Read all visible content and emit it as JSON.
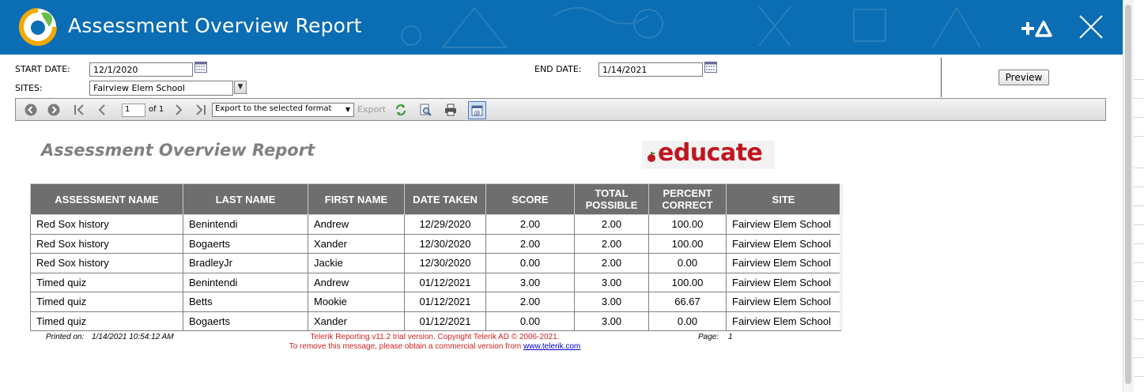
{
  "header": {
    "title": "Assessment Overview Report",
    "colors": {
      "bar": "#0b6db3",
      "text": "#ffffff"
    },
    "icons": {
      "logo": "circle-swoosh-logo",
      "accessibility": "plus-a-icon",
      "close": "close-icon"
    }
  },
  "params": {
    "start_date_label": "START DATE:",
    "start_date_value": "12/1/2020",
    "end_date_label": "END DATE:",
    "end_date_value": "1/14/2021",
    "sites_label": "SITES:",
    "sites_value": "Fairview Elem School",
    "preview_label": "Preview"
  },
  "toolbar": {
    "page_value": "1",
    "page_of": "of 1",
    "export_format": "Export to the selected format",
    "export_label": "Export"
  },
  "report": {
    "title": "Assessment Overview Report",
    "brand": "educate",
    "brand_color": "#c0161f",
    "columns": [
      "ASSESSMENT NAME",
      "LAST NAME",
      "FIRST NAME",
      "DATE TAKEN",
      "SCORE",
      "TOTAL POSSIBLE",
      "PERCENT CORRECT",
      "SITE"
    ],
    "rows": [
      [
        "Red Sox history",
        "Benintendi",
        "Andrew",
        "12/29/2020",
        "2.00",
        "2.00",
        "100.00",
        "Fairview Elem School"
      ],
      [
        "Red Sox history",
        "Bogaerts",
        "Xander",
        "12/30/2020",
        "2.00",
        "2.00",
        "100.00",
        "Fairview Elem School"
      ],
      [
        "Red Sox history",
        "BradleyJr",
        "Jackie",
        "12/30/2020",
        "0.00",
        "2.00",
        "0.00",
        "Fairview Elem School"
      ],
      [
        "Timed quiz",
        "Benintendi",
        "Andrew",
        "01/12/2021",
        "3.00",
        "3.00",
        "100.00",
        "Fairview Elem School"
      ],
      [
        "Timed quiz",
        "Betts",
        "Mookie",
        "01/12/2021",
        "2.00",
        "3.00",
        "66.67",
        "Fairview Elem School"
      ],
      [
        "Timed quiz",
        "Bogaerts",
        "Xander",
        "01/12/2021",
        "0.00",
        "3.00",
        "0.00",
        "Fairview Elem School"
      ]
    ]
  },
  "footer": {
    "printed_label": "Printed on:",
    "printed_value": "1/14/2021 10:54:12 AM",
    "page_label": "Page:",
    "page_value": "1",
    "trial_line1": "Telerik Reporting v11.2 trial version. Copyright Telerik AD © 2006-2021.",
    "trial_line2": "To remove this message, please obtain a commercial version from",
    "trial_link": "www.telerik.com"
  }
}
